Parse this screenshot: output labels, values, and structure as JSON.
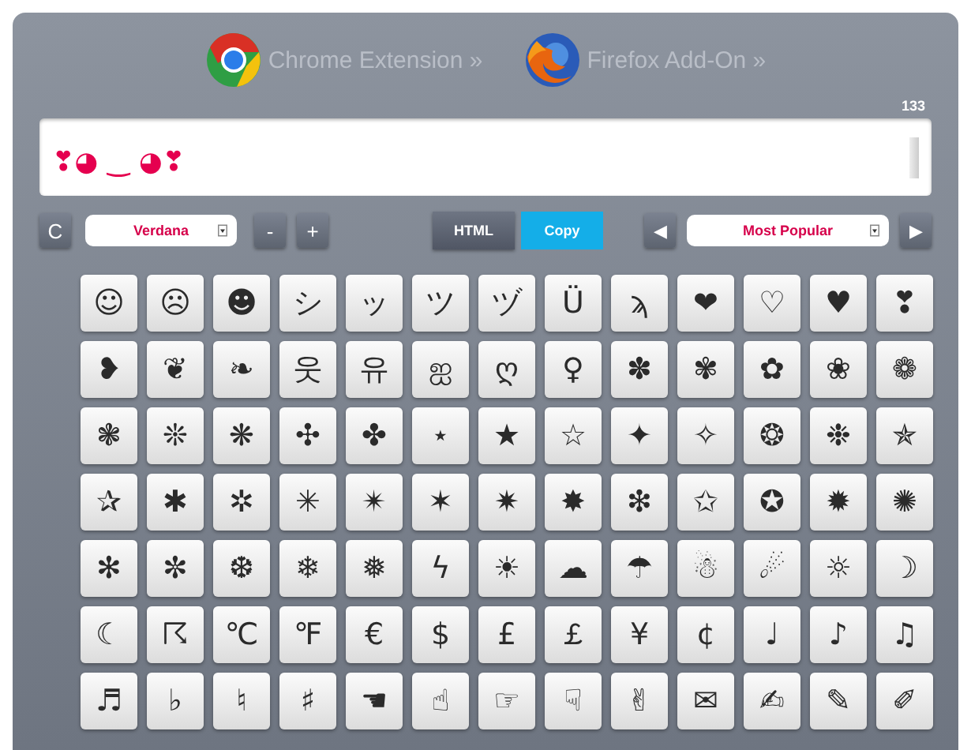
{
  "links": [
    {
      "label": "Chrome Extension »",
      "kind": "chrome"
    },
    {
      "label": "Firefox Add-On »",
      "kind": "firefox"
    }
  ],
  "counter": "133",
  "editor": {
    "value": "❣◕ ‿ ◕❣"
  },
  "toolbar": {
    "clear": "C",
    "font": "Verdana",
    "decrease": "-",
    "increase": "+",
    "html": "HTML",
    "copy": "Copy",
    "prev": "◀",
    "category": "Most Popular",
    "next": "▶"
  },
  "symbols": [
    [
      "☺",
      "☹",
      "☻",
      "シ",
      "ッ",
      "ツ",
      "ヅ",
      "Ü",
      "ϡ",
      "❤",
      "♡",
      "♥",
      "❣"
    ],
    [
      "❥",
      "❦",
      "❧",
      "웃",
      "유",
      "ஐ",
      "ღ",
      "♀",
      "✽",
      "✾",
      "✿",
      "❀",
      "❁"
    ],
    [
      "❃",
      "❊",
      "❋",
      "✣",
      "✤",
      "⋆",
      "★",
      "☆",
      "✦",
      "✧",
      "❂",
      "❉",
      "✯"
    ],
    [
      "✰",
      "✱",
      "✲",
      "✳",
      "✴",
      "✶",
      "✷",
      "✸",
      "❇",
      "✩",
      "✪",
      "✹",
      "✺"
    ],
    [
      "✻",
      "✼",
      "❆",
      "❄",
      "❅",
      "ϟ",
      "☀",
      "☁",
      "☂",
      "☃",
      "☄",
      "☼",
      "☽"
    ],
    [
      "☾",
      "☈",
      "℃",
      "℉",
      "€",
      "$",
      "£",
      "￡",
      "¥",
      "¢",
      "♩",
      "♪",
      "♫"
    ],
    [
      "♬",
      "♭",
      "♮",
      "♯",
      "☚",
      "☝",
      "☞",
      "☟",
      "✌",
      "✉",
      "✍",
      "✎",
      "✐"
    ]
  ]
}
